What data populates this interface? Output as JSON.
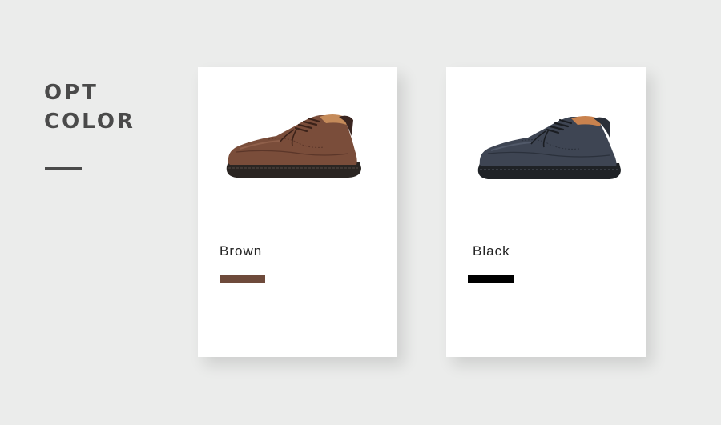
{
  "header": {
    "line1": "OPT",
    "line2": "COLOR"
  },
  "options": [
    {
      "name": "Brown",
      "swatch_color": "#6e4a3b",
      "icon": "brown-shoe-image"
    },
    {
      "name": "Black",
      "swatch_color": "#000000",
      "icon": "black-shoe-image"
    }
  ],
  "colors": {
    "background": "#ebeceb",
    "heading": "#4a4a4a",
    "card": "#ffffff"
  }
}
